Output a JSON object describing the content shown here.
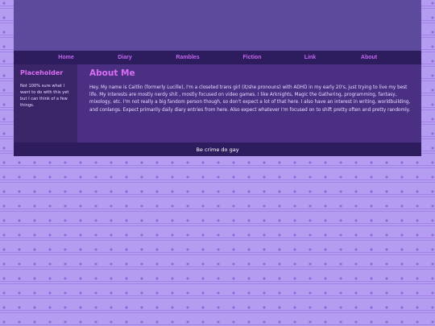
{
  "nav": {
    "items": [
      {
        "label": "Home"
      },
      {
        "label": "Diary"
      },
      {
        "label": "Rambles"
      },
      {
        "label": "Fiction"
      },
      {
        "label": "Link"
      },
      {
        "label": "About"
      }
    ]
  },
  "sidebar": {
    "title": "Placeholder",
    "text": "Not 100% sure what I want to do with this yet but I can think of a few things."
  },
  "main": {
    "title": "About Me",
    "text": "Hey. My name is Caitlin (formerly Lucille), I'm a closeted trans girl (it/she pronouns) with ADHD in my early 20's, just trying to live my best life. My interests are mostly nerdy shit , mostly focused on video games. I like Arknights, Magic the Gathering, programming, fantasy, mixology, etc. I'm not really a big fandom person though, so don't expect a lot of that here. I also have an interest in writing, worldbuilding, and conlangs. Expect primarily daily diary entries from here. Also expect whatever I'm focused on to shift pretty often and pretty randomly."
  },
  "footer": {
    "text": "Be crime do gay"
  },
  "colors": {
    "accent": "#d86ef2",
    "nav_link": "#c266ee",
    "nav_bg": "#2d1d5e",
    "banner": "#5c4a9c",
    "content_bg": "#4a2f82"
  }
}
